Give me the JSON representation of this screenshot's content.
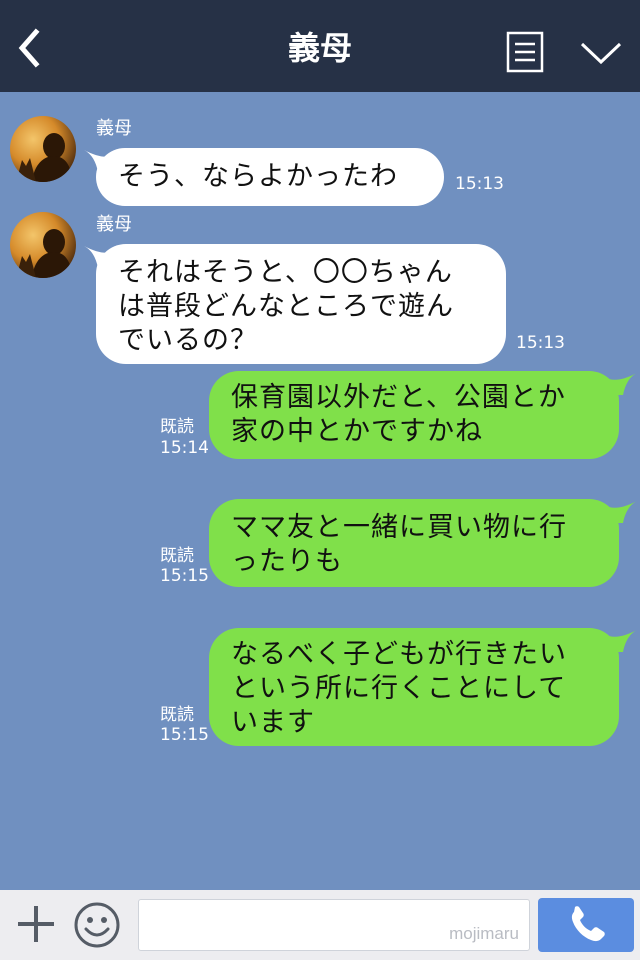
{
  "header": {
    "title": "義母",
    "back_icon": "chevron-left-icon",
    "menu_icon": "list-menu-icon",
    "more_icon": "chevron-down-icon"
  },
  "messages": [
    {
      "direction": "in",
      "sender": "義母",
      "lines": [
        "そう、ならよかったわ"
      ],
      "time": "15:13"
    },
    {
      "direction": "in",
      "sender": "義母",
      "lines": [
        "それはそうと、〇〇ちゃん",
        "は普段どんなところで遊ん",
        "でいるの？"
      ],
      "time": "15:13"
    },
    {
      "direction": "out",
      "read": "既読",
      "lines": [
        "保育園以外だと、公園とか",
        "家の中とかですかね"
      ],
      "time": "15:14"
    },
    {
      "direction": "out",
      "read": "既読",
      "lines": [
        "ママ友と一緒に買い物に行",
        "ったりも"
      ],
      "time": "15:15"
    },
    {
      "direction": "out",
      "read": "既読",
      "lines": [
        "なるべく子どもが行きたい",
        "という所に行くことにして",
        "います"
      ],
      "time": "15:15"
    }
  ],
  "footer": {
    "plus_icon": "plus-icon",
    "emoji_icon": "smiley-icon",
    "input_value": "",
    "watermark": "mojimaru",
    "call_icon": "phone-icon"
  },
  "colors": {
    "header_bg": "#263146",
    "chat_bg": "#7090c0",
    "incoming_bubble": "#ffffff",
    "outgoing_bubble": "#80e04a",
    "call_button": "#5b8de0"
  }
}
